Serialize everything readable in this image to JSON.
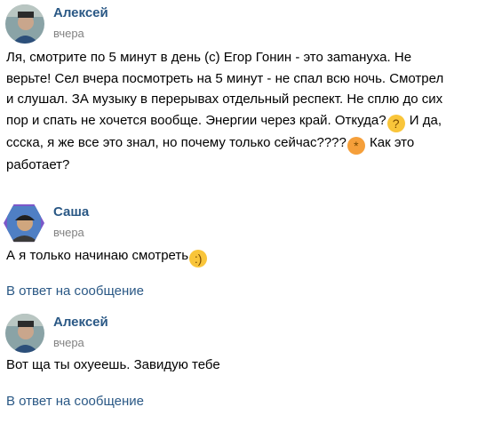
{
  "comments": [
    {
      "author": "Алексей",
      "date": "вчера",
      "text_part1": "Ля, смотрите по 5 минут в день (с) Егор Гонин - это заmануха. Не верьте! Сел вчера посмотреть на 5 минут - не спал всю ночь. Смотрел и слушал. ЗА музыку в перерывах отдельный респект. Не сплю до сих пор и спать не хочется вообще. Энергии через край. Откуда?",
      "emoji1": "thinking-face",
      "text_part2": " И да, ссска, я же все это знал, но почему только сейчас????",
      "emoji2": "exploding-head",
      "text_part3": " Как это работает?"
    },
    {
      "author": "Саша",
      "date": "вчера",
      "text": "А я только начинаю смотреть",
      "emoji": "smiling-face",
      "reply_link": "В ответ на сообщение"
    },
    {
      "author": "Алексей",
      "date": "вчера",
      "text": "Вот ща ты охуеешь. Завидую тебе",
      "reply_link": "В ответ на сообщение"
    }
  ],
  "colors": {
    "link": "#2a5885",
    "meta": "#828282",
    "text": "#000000",
    "avatar_hex_border": "#7b58c9"
  }
}
